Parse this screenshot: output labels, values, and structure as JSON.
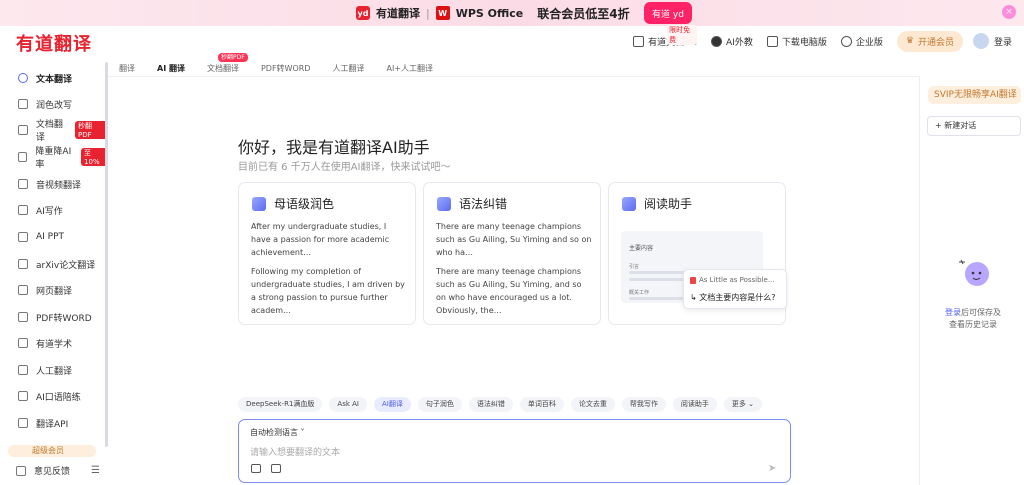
{
  "banner": {
    "brand1": "有道翻译",
    "brand2": "WPS Office",
    "promo": "联合会员低至4折",
    "yd_logo": "yd",
    "wps_logo": "W",
    "gift": "有道 yd"
  },
  "header": {
    "logo": "有道翻译",
    "nav": [
      {
        "label": "有道文档FM",
        "badge": "限时免费",
        "icon": "doc-icon"
      },
      {
        "label": "AI外教",
        "icon": "avatar-icon"
      },
      {
        "label": "下载电脑版",
        "icon": "download-icon"
      },
      {
        "label": "企业版",
        "icon": "enterprise-icon"
      }
    ],
    "vip_label": "开通会员",
    "login_label": "登录"
  },
  "sidebar": {
    "items": [
      {
        "label": "文本翻译",
        "active": true
      },
      {
        "label": "润色改写"
      },
      {
        "label": "文档翻译",
        "tag": "秒翻PDF"
      },
      {
        "label": "降重降AI率",
        "tag": "至10%"
      },
      {
        "label": "音视频翻译"
      },
      {
        "label": "AI写作"
      },
      {
        "label": "AI PPT"
      },
      {
        "label": "arXiv论文翻译"
      },
      {
        "label": "网页翻译"
      },
      {
        "label": "PDF转WORD"
      },
      {
        "label": "有道学术"
      },
      {
        "label": "人工翻译"
      },
      {
        "label": "AI口语陪练"
      },
      {
        "label": "翻译API"
      }
    ],
    "vip": "超级会员",
    "feedback": "意见反馈",
    "menu_glyph": "☰"
  },
  "tabs": [
    {
      "label": "翻译"
    },
    {
      "label": "AI 翻译",
      "active": true
    },
    {
      "label": "文档翻译",
      "hot": "秒翻PDF"
    },
    {
      "label": "PDF转WORD"
    },
    {
      "label": "人工翻译"
    },
    {
      "label": "AI+人工翻译"
    }
  ],
  "main": {
    "greeting": "你好，我是有道翻译AI助手",
    "subgreeting": "目前已有 6 千万人在使用AI翻译，快来试试吧～",
    "cards": [
      {
        "title": "母语级润色",
        "p1": "After my undergraduate studies, I have a passion for more academic achievement…",
        "p2": "Following my completion of undergraduate studies, I am driven by a strong passion to pursue further academ…"
      },
      {
        "title": "语法纠错",
        "p1": "There are many teenage champions such as Gu Ailing, Su Yiming and so on who ha…",
        "p2": "There are many teenage champions such as Gu Ailing, Su Yiming, and so on who have encouraged us a lot. Obviously, the…"
      },
      {
        "title": "阅读助手",
        "mock_title": "主要内容",
        "mock_sub1": "引言",
        "mock_sub2": "概关工作",
        "popup_file": "As Little as Possible...",
        "popup_q": "↳ 文档主要内容是什么?"
      }
    ],
    "chips": [
      "DeepSeek-R1满血版",
      "Ask AI",
      "AI翻译",
      "句子润色",
      "语法纠错",
      "单词百科",
      "论文去重",
      "帮我写作",
      "阅读助手",
      "更多 ⌄"
    ],
    "active_chip": "AI翻译",
    "input": {
      "lang": "自动检测语言 ˅",
      "placeholder": "请输入想要翻译的文本"
    }
  },
  "right_panel": {
    "vip": "SVIP无限畅享AI翻译",
    "new_chat": "+ 新建对话",
    "login_link": "登录",
    "hint1": "后可保存及",
    "hint2": "查看历史记录"
  },
  "colors": {
    "brand_red": "#e8222e",
    "accent": "#5b6cf0",
    "vip": "#c27a2e"
  }
}
